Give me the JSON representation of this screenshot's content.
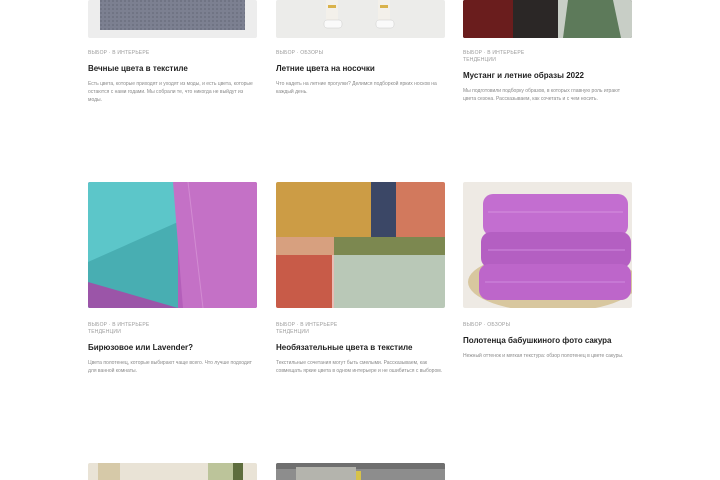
{
  "articles": [
    {
      "meta": [
        "ВЫБОР",
        "В ИНТЕРЬЕРЕ"
      ],
      "title": "Вечные цвета в текстиле",
      "excerpt": "Есть цвета, которые приходят и уходят из моды, и есть цвета, которые остаются с нами годами. Мы собрали те, что никогда не выйдут из моды."
    },
    {
      "meta": [
        "ВЫБОР",
        "ОБЗОРЫ"
      ],
      "title": "Летние цвета на носочки",
      "excerpt": "Что надеть на летние прогулки? Делимся подборкой ярких носков на каждый день."
    },
    {
      "meta": [
        "ВЫБОР",
        "В ИНТЕРЬЕРЕ",
        "ТЕНДЕНЦИИ"
      ],
      "title": "Мустанг и летние образы 2022",
      "excerpt": "Мы подготовили подборку образов, в которых главную роль играют цвета сезона. Рассказываем, как сочетать и с чем носить."
    },
    {
      "meta": [
        "ВЫБОР",
        "В ИНТЕРЬЕРЕ",
        "ТЕНДЕНЦИИ"
      ],
      "title": "Бирюзовое или Lavender?",
      "excerpt": "Цвета полотенец, которые выбирают чаще всего. Что лучше подходит для ванной комнаты."
    },
    {
      "meta": [
        "ВЫБОР",
        "В ИНТЕРЬЕРЕ",
        "ТЕНДЕНЦИИ"
      ],
      "title": "Необязательные цвета в текстиле",
      "excerpt": "Текстильные сочетания могут быть смелыми. Рассказываем, как совмещать яркие цвета в одном интерьере и не ошибиться с выбором."
    },
    {
      "meta": [
        "ВЫБОР",
        "ОБЗОРЫ"
      ],
      "title": "Полотенца бабушкиного фото сакура",
      "excerpt": "Нежный оттенок и мягкая текстура: обзор полотенец в цвете сакуры."
    },
    {
      "meta": [],
      "title": "",
      "excerpt": ""
    },
    {
      "meta": [],
      "title": "",
      "excerpt": ""
    }
  ]
}
